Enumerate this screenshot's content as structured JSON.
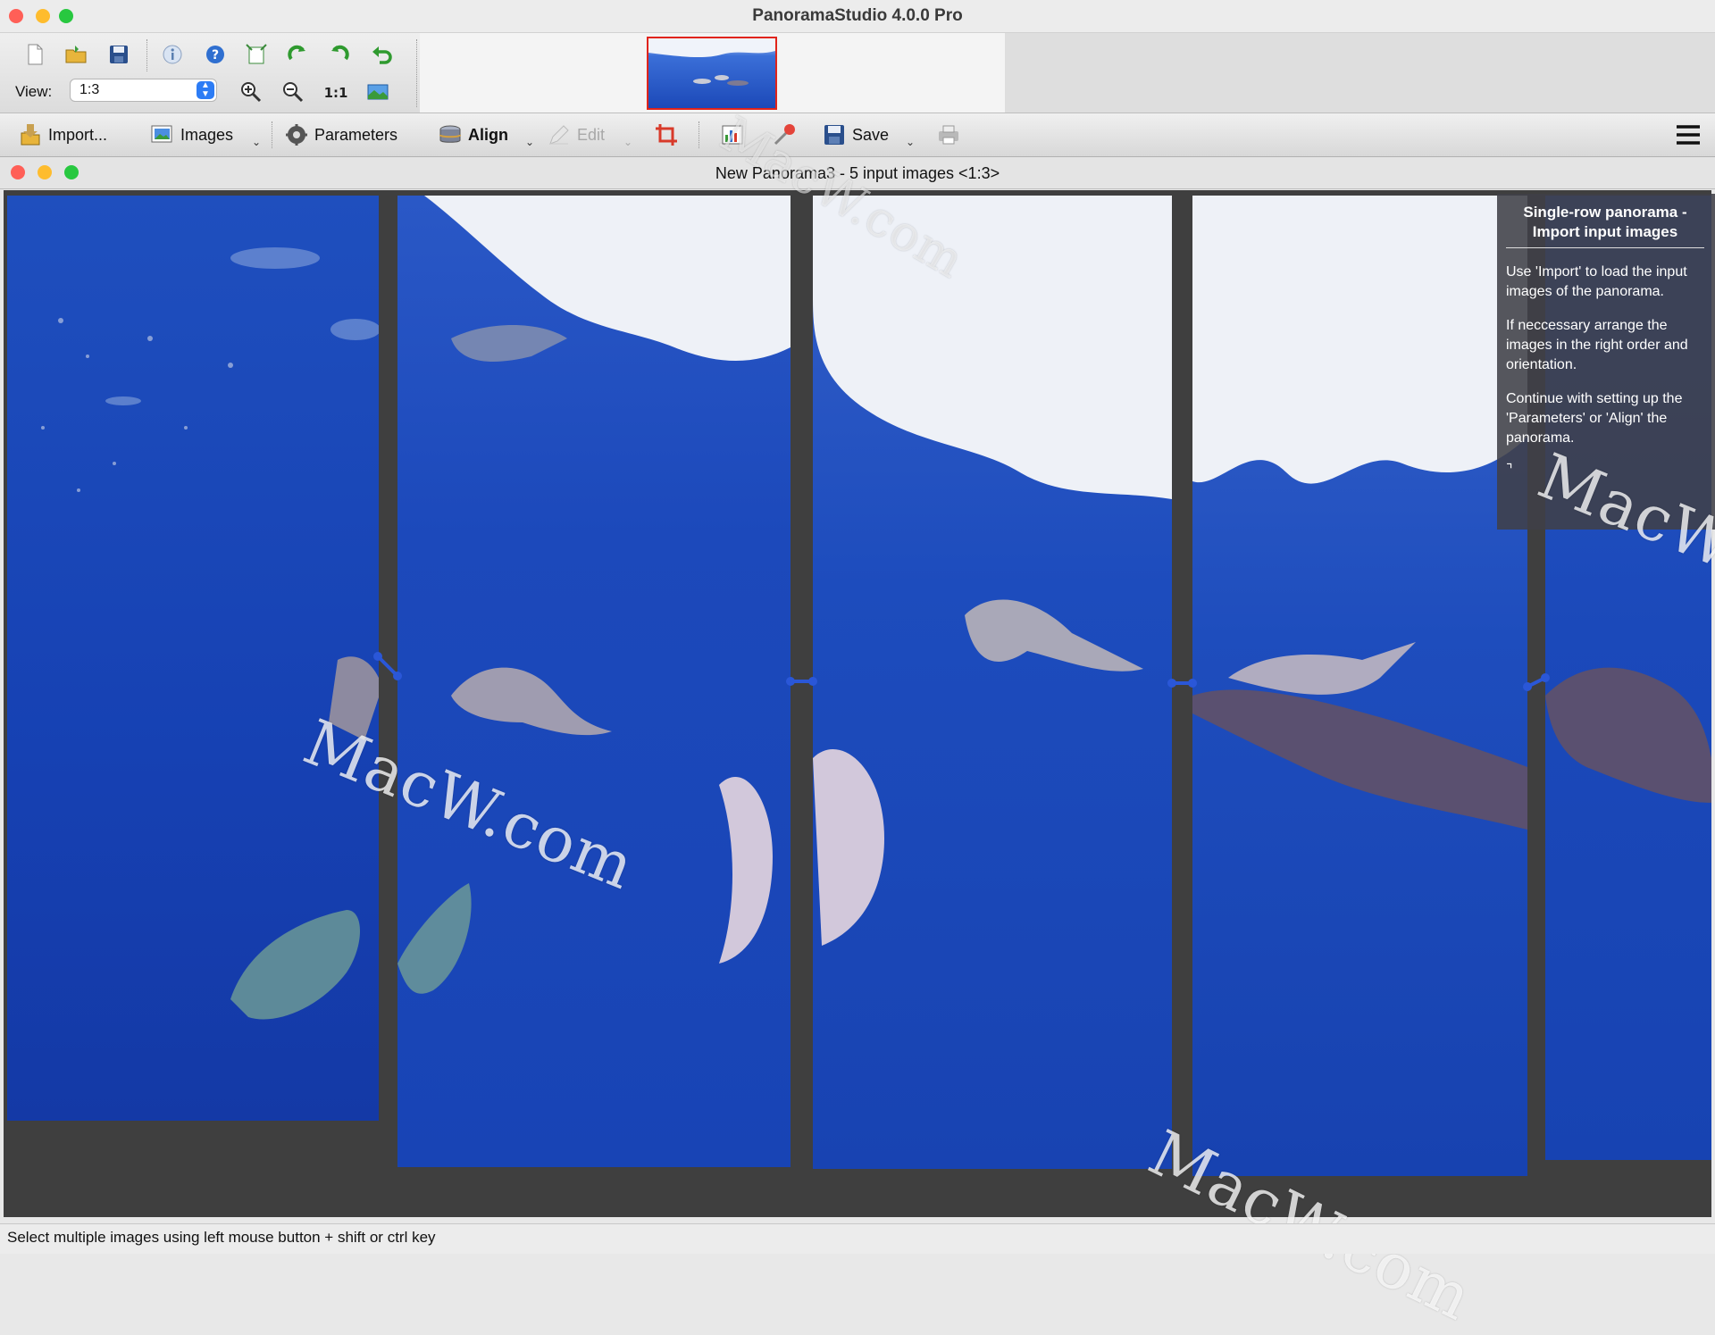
{
  "app": {
    "title": "PanoramaStudio 4.0.0 Pro"
  },
  "toolbar": {
    "view_label": "View:",
    "view_value": "1:3",
    "buttons": {
      "import": "Import...",
      "images": "Images",
      "parameters": "Parameters",
      "align": "Align",
      "edit": "Edit",
      "save": "Save"
    }
  },
  "document": {
    "title": "New Panorama3 - 5 input images <1:3>"
  },
  "help_panel": {
    "title": "Single-row panorama - Import input images",
    "paragraphs": [
      "Use 'Import' to load the input images of the panorama.",
      "If neccessary arrange the images in the right order and orientation.",
      "Continue with setting up the 'Parameters' or 'Align' the panorama."
    ]
  },
  "watermark": "MacW.com",
  "status": {
    "text": "Select multiple images using left mouse button + shift or ctrl key"
  },
  "colors": {
    "traffic_close": "#ff5f57",
    "traffic_min": "#febc2e",
    "traffic_max": "#28c840",
    "canvas_bg": "#3f3f3f",
    "accent": "#2c7cf5"
  }
}
